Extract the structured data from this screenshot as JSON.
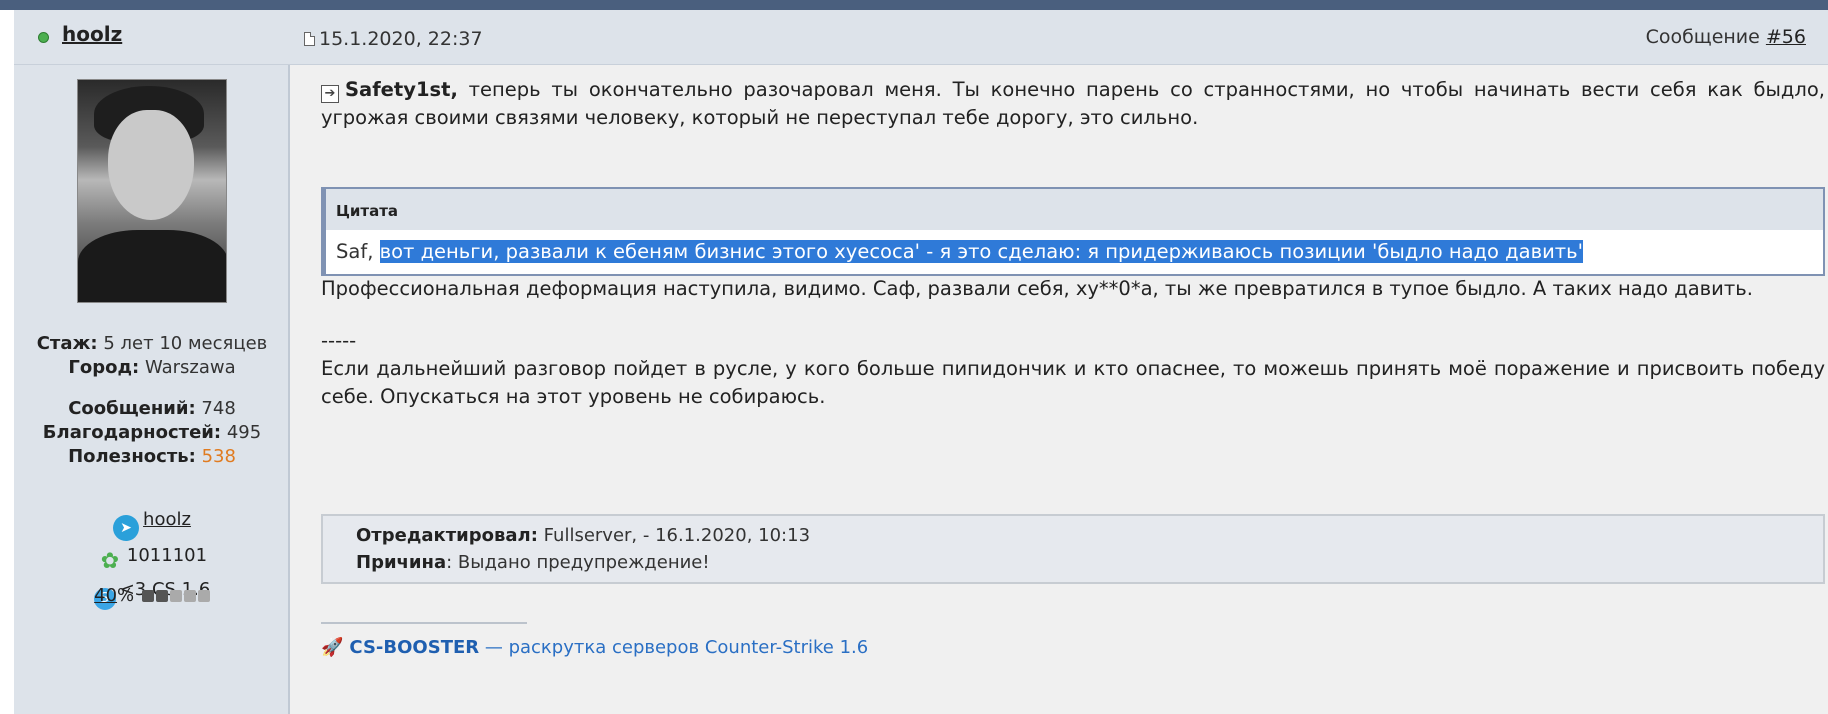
{
  "post": {
    "username": "hoolz",
    "date": "15.1.2020, 22:37",
    "message_label": "Сообщение",
    "message_number": "#56"
  },
  "sidebar": {
    "stats": [
      {
        "label": "Стаж:",
        "value": "5 лет 10 месяцев"
      },
      {
        "label": "Город:",
        "value": "Warszawa"
      },
      {
        "label": "Сообщений:",
        "value": "748"
      },
      {
        "label": "Благодарностей:",
        "value": "495"
      },
      {
        "label": "Полезность:",
        "value": "538"
      }
    ],
    "contacts": {
      "telegram": "hoolz",
      "icq": "1011101",
      "skype": "<3 CS 1.6"
    },
    "reputation": {
      "percent": "40",
      "suffix": "%",
      "level": 0.4
    }
  },
  "content": {
    "intro_name": "Safety1st,",
    "intro_text": " теперь ты окончательно разочаровал меня. Ты конечно парень со странностями, но чтобы начинать вести себя как быдло, угрожая своими связями человеку, который не переступал тебе дорогу, это сильно.",
    "quote": {
      "title": "Цитата",
      "prefix": "Saf, ",
      "highlighted": "вот деньги, развали к ебеням бизнис этого хуесоса' - я это сделаю: я придерживаюсь позиции 'быдло надо давить'"
    },
    "paragraph2": "Профессиональная деформация наступила, видимо. Саф, развали себя, ху**0*а, ты же превратился в тупое быдло. А таких надо давить.",
    "separator": "-----",
    "paragraph3": "Если дальнейший разговор пойдет в русле, у кого больше пипидончик и кто опаснее, то можешь принять моё поражение и присвоить победу себе. Опускаться на этот уровень не собираюсь.",
    "edit": {
      "edited_label": "Отредактировал:",
      "edited_value": " Fullserver, - 16.1.2020, 10:13",
      "reason_label": "Причина",
      "reason_value": ": Выдано предупреждение!"
    },
    "signature": {
      "brand": "CS-BOOSTER",
      "text": " — раскрутка серверов Counter-Strike 1.6"
    }
  },
  "colors": {
    "header_bg": "#dde3ea",
    "content_bg": "#f0f0f0",
    "highlight": "#2f7ad8",
    "link": "#2a6fc4",
    "utility": "#e07b20"
  }
}
